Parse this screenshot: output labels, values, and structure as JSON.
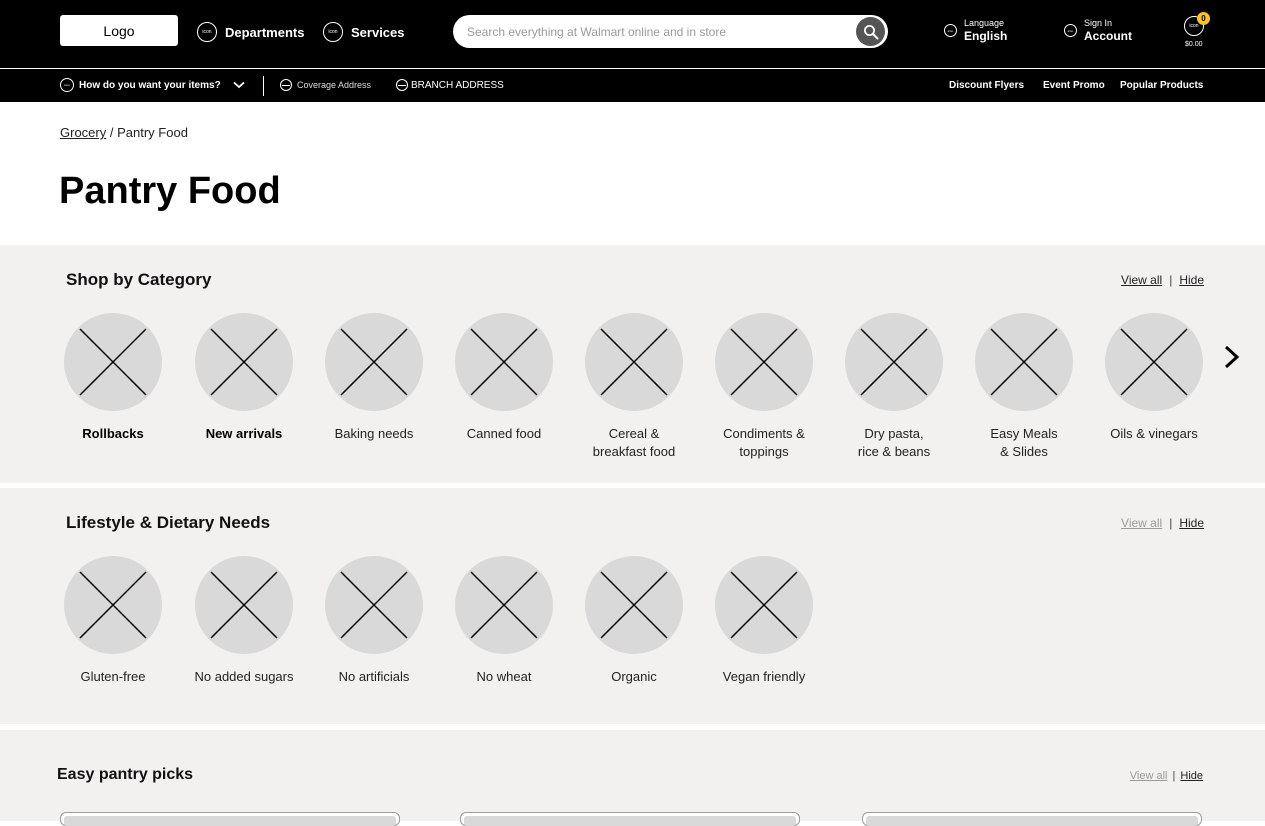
{
  "header": {
    "logo": "Logo",
    "icon_text": "icon",
    "departments": "Departments",
    "services": "Services",
    "search_placeholder": "Search everything at Walmart online and in store",
    "language_label": "Language",
    "language_value": "English",
    "signin_label": "Sign In",
    "account_label": "Account",
    "cart_count": "0",
    "cart_total": "$0.00"
  },
  "subnav": {
    "delivery": "How do you want your items?",
    "coverage": "Coverage Address",
    "branch": "BRANCH ADDRESS",
    "links": [
      "Discount Flyers",
      "Event Promo",
      "Popular Products"
    ]
  },
  "breadcrumb": {
    "parent": "Grocery",
    "separator": "/",
    "current": "Pantry Food"
  },
  "page_title": "Pantry Food",
  "shop_by_category": {
    "title": "Shop by Category",
    "view_all": "View all",
    "hide": "Hide",
    "items": [
      {
        "line1": "Rollbacks",
        "line2": "",
        "bold": true
      },
      {
        "line1": "New arrivals",
        "line2": "",
        "bold": true
      },
      {
        "line1": "Baking needs",
        "line2": "",
        "bold": false
      },
      {
        "line1": "Canned food",
        "line2": "",
        "bold": false
      },
      {
        "line1": "Cereal &",
        "line2": "breakfast food",
        "bold": false
      },
      {
        "line1": "Condiments &",
        "line2": "toppings",
        "bold": false
      },
      {
        "line1": "Dry pasta,",
        "line2": "rice & beans",
        "bold": false
      },
      {
        "line1": "Easy Meals",
        "line2": "& Slides",
        "bold": false
      },
      {
        "line1": "Oils & vinegars",
        "line2": "",
        "bold": false
      }
    ]
  },
  "lifestyle": {
    "title": "Lifestyle & Dietary Needs",
    "view_all": "View all",
    "hide": "Hide",
    "items": [
      "Gluten-free",
      "No added sugars",
      "No artificials",
      "No wheat",
      "Organic",
      "Vegan friendly"
    ]
  },
  "easy_pantry": {
    "title": "Easy pantry picks",
    "view_all": "View all",
    "hide": "Hide"
  },
  "colors": {
    "bar": "#000000",
    "section_bg": "#f2f1f0",
    "placeholder": "#d9d9d9",
    "badge": "#ffc220"
  }
}
